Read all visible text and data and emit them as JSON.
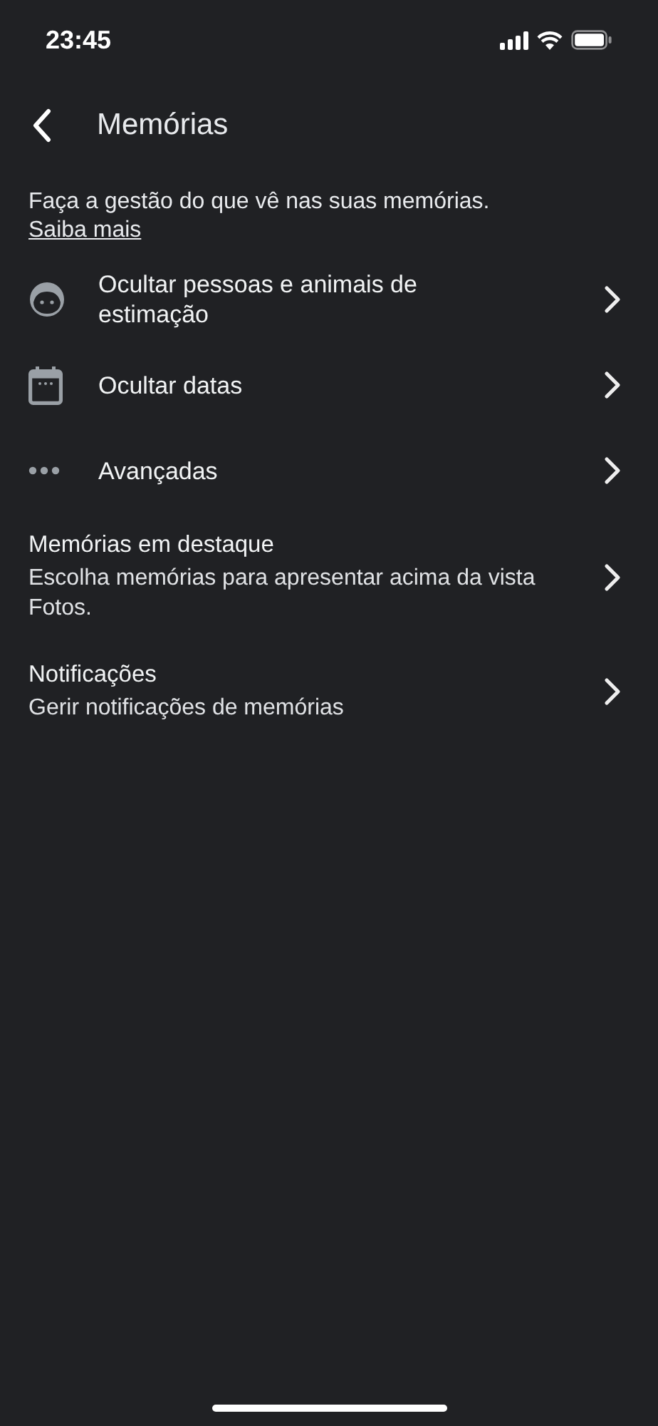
{
  "status_bar": {
    "time": "23:45"
  },
  "header": {
    "title": "Memórias"
  },
  "intro": {
    "text": "Faça a gestão do que vê nas suas memórias.",
    "link": "Saiba mais"
  },
  "items": [
    {
      "kind": "face",
      "title": "Ocultar pessoas e animais de estimação"
    },
    {
      "kind": "calendar",
      "title": "Ocultar datas"
    },
    {
      "kind": "more",
      "title": "Avançadas"
    },
    {
      "kind": "text",
      "title": "Memórias em destaque",
      "subtitle": "Escolha memórias para apresentar acima da vista Fotos."
    },
    {
      "kind": "text",
      "title": "Notificações",
      "subtitle": "Gerir notificações de memórias"
    }
  ]
}
